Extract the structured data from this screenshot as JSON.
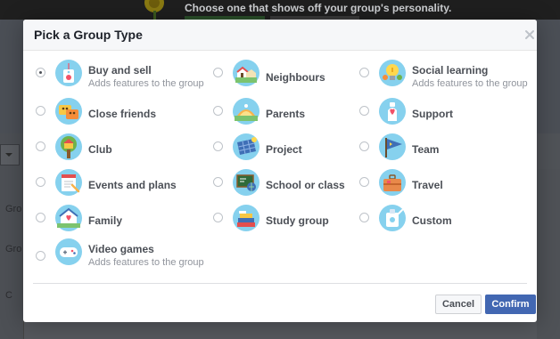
{
  "background": {
    "headline": "Choose one that shows off your group's personality.",
    "side_text": [
      "Gro",
      "Gro",
      "C"
    ]
  },
  "dialog": {
    "title": "Pick a Group Type",
    "options": [
      {
        "label": "Buy and sell",
        "sub": "Adds features to the group",
        "icon": "price-tag-icon",
        "selected": true
      },
      {
        "label": "Neighbours",
        "sub": "",
        "icon": "neighbourhood-icon",
        "selected": false
      },
      {
        "label": "Social learning",
        "sub": "Adds features to the group",
        "icon": "lightbulb-icon",
        "selected": false
      },
      {
        "label": "Close friends",
        "sub": "",
        "icon": "friends-icon",
        "selected": false
      },
      {
        "label": "Parents",
        "sub": "",
        "icon": "parents-icon",
        "selected": false
      },
      {
        "label": "Support",
        "sub": "",
        "icon": "heart-hand-icon",
        "selected": false
      },
      {
        "label": "Club",
        "sub": "",
        "icon": "club-tree-icon",
        "selected": false
      },
      {
        "label": "Project",
        "sub": "",
        "icon": "solar-panel-icon",
        "selected": false
      },
      {
        "label": "Team",
        "sub": "",
        "icon": "pennant-flag-icon",
        "selected": false
      },
      {
        "label": "Events and plans",
        "sub": "",
        "icon": "calendar-icon",
        "selected": false
      },
      {
        "label": "School or class",
        "sub": "",
        "icon": "chalkboard-icon",
        "selected": false
      },
      {
        "label": "Travel",
        "sub": "",
        "icon": "suitcase-icon",
        "selected": false
      },
      {
        "label": "Family",
        "sub": "",
        "icon": "house-heart-icon",
        "selected": false
      },
      {
        "label": "Study group",
        "sub": "",
        "icon": "books-icon",
        "selected": false
      },
      {
        "label": "Custom",
        "sub": "",
        "icon": "custom-icon",
        "selected": false
      },
      {
        "label": "Video games",
        "sub": "Adds features to the group",
        "icon": "gamepad-icon",
        "selected": false
      }
    ],
    "cancel_label": "Cancel",
    "confirm_label": "Confirm"
  },
  "colors": {
    "icon_circle": "#86d1ee",
    "confirm_button": "#4267b2",
    "label_text": "#4b4f56",
    "sub_text": "#90949c"
  }
}
